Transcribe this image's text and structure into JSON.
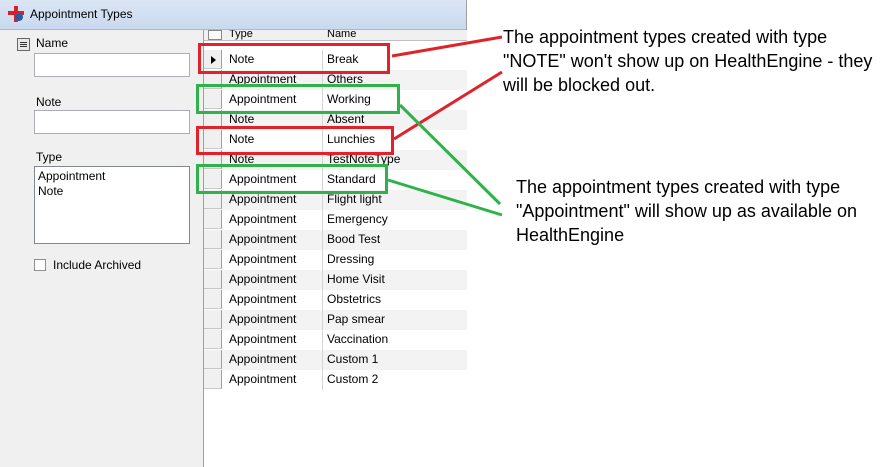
{
  "window": {
    "title": "Appointment Types"
  },
  "filters": {
    "name_label": "Name",
    "name_value": "",
    "note_label": "Note",
    "note_value": "",
    "type_label": "Type",
    "type_options": [
      "Appointment",
      "Note"
    ],
    "include_archived_label": "Include Archived",
    "include_archived_checked": false
  },
  "grid": {
    "headers": [
      "Type",
      "Name"
    ],
    "rows": [
      {
        "type": "Note",
        "name": "Break"
      },
      {
        "type": "Appointment",
        "name": "Others"
      },
      {
        "type": "Appointment",
        "name": "Working"
      },
      {
        "type": "Note",
        "name": "Absent"
      },
      {
        "type": "Note",
        "name": "Lunchies"
      },
      {
        "type": "Note",
        "name": "TestNoteType"
      },
      {
        "type": "Appointment",
        "name": "Standard"
      },
      {
        "type": "Appointment",
        "name": "Flight light"
      },
      {
        "type": "Appointment",
        "name": "Emergency"
      },
      {
        "type": "Appointment",
        "name": "Bood Test"
      },
      {
        "type": "Appointment",
        "name": "Dressing"
      },
      {
        "type": "Appointment",
        "name": "Home Visit"
      },
      {
        "type": "Appointment",
        "name": "Obstetrics"
      },
      {
        "type": "Appointment",
        "name": "Pap smear"
      },
      {
        "type": "Appointment",
        "name": "Vaccination"
      },
      {
        "type": "Appointment",
        "name": "Custom 1"
      },
      {
        "type": "Appointment",
        "name": "Custom 2"
      }
    ]
  },
  "annotations": {
    "note_text": "The appointment types created with type \"NOTE\" won't show up on HealthEngine - they will be blocked out.",
    "appointment_text": "The appointment types created with type \"Appointment\" will show up as available on HealthEngine"
  },
  "colors": {
    "note_highlight": "#e0222b",
    "appointment_highlight": "#2db34a"
  }
}
